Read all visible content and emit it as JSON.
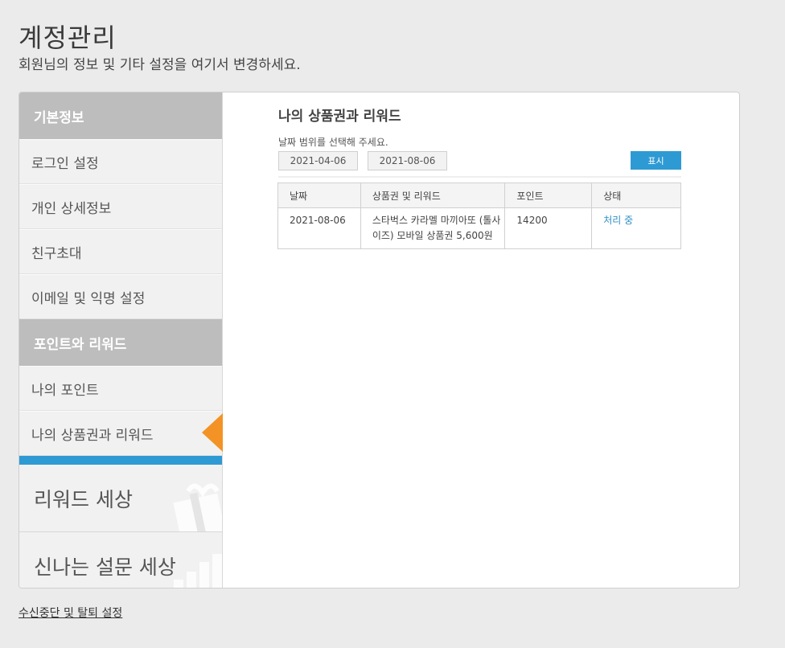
{
  "header": {
    "title": "계정관리",
    "subtitle": "회원님의 정보 및 기타 설정을 여기서 변경하세요."
  },
  "sidebar": {
    "section1": "기본정보",
    "items1": [
      "로그인 설정",
      "개인 상세정보",
      "친구초대",
      "이메일 및 익명 설정"
    ],
    "section2": "포인트와 리워드",
    "items2": [
      "나의 포인트",
      "나의 상품권과 리워드"
    ],
    "active_item": "나의 상품권과 리워드",
    "promos": [
      "리워드 세상",
      "신나는 설문 세상"
    ],
    "accent_color": "#2e9ad3",
    "arrow_color": "#f39325"
  },
  "content": {
    "title": "나의 상품권과 리워드",
    "hint": "날짜 범위를 선택해 주세요.",
    "date_from": "2021-04-06",
    "date_to": "2021-08-06",
    "show_button": "표시",
    "table": {
      "headers": [
        "날짜",
        "상품권 및 리워드",
        "포인트",
        "상태"
      ],
      "rows": [
        {
          "date": "2021-08-06",
          "reward": "스타벅스 카라멜 마끼아또 (톨사이즈) 모바일 상품권 5,600원",
          "points": "14200",
          "status": "처리 중"
        }
      ]
    }
  },
  "footer": {
    "link": "수신중단 및 탈퇴 설정"
  }
}
